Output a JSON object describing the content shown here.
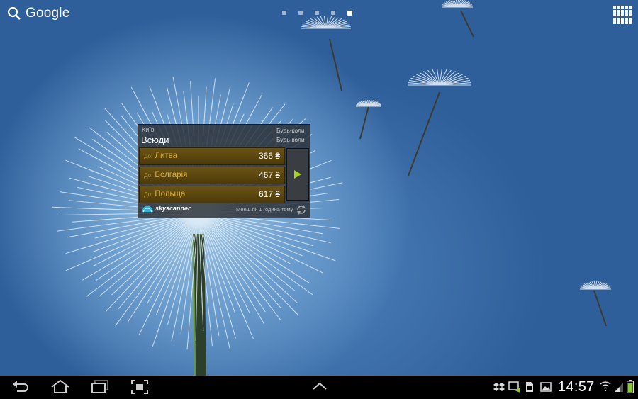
{
  "home": {
    "search_label": "Google",
    "pages": [
      false,
      false,
      false,
      false,
      true
    ]
  },
  "widget": {
    "origin": "Київ",
    "destination": "Всюди",
    "date_out": "Будь-коли",
    "date_back": "Будь-коли",
    "to_prefix": "До:",
    "rows": [
      {
        "country": "Литва",
        "price": "366 ₴"
      },
      {
        "country": "Болгарія",
        "price": "467 ₴"
      },
      {
        "country": "Польща",
        "price": "617 ₴"
      }
    ],
    "brand": "skyscanner",
    "updated": "Менш як 1 година тому",
    "accent_color": "#a6d41e"
  },
  "status": {
    "time": "14:57",
    "icons": [
      "dropbox-icon",
      "screen-mirror-icon",
      "sd-card-icon",
      "gallery-icon",
      "wifi-icon",
      "signal-icon",
      "battery-icon"
    ]
  }
}
